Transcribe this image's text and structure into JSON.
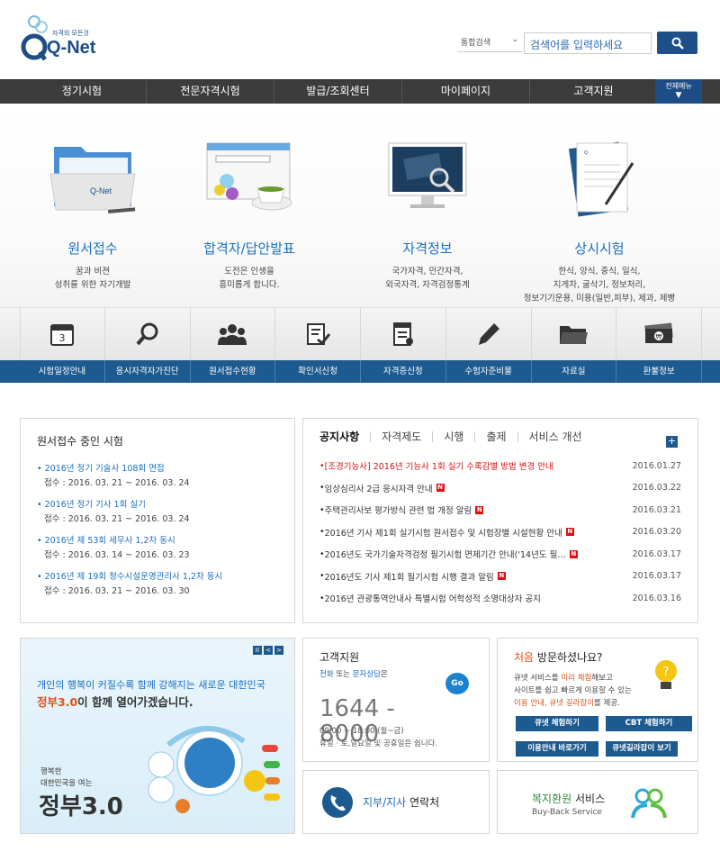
{
  "header": {
    "logo_tagline": "자격의 모든것",
    "logo_text": "Q-Net",
    "search_scope": "통합검색",
    "search_placeholder": "검색어를 입력하세요"
  },
  "nav": {
    "items": [
      "정기시험",
      "전문자격시험",
      "발급/조회센터",
      "마이페이지",
      "고객지원"
    ],
    "all_menu": "전체메뉴"
  },
  "services": [
    {
      "title": "원서접수",
      "desc": [
        "꿈과 비젼",
        "성취를 위한 자기개발"
      ]
    },
    {
      "title": "합격자/답안발표",
      "desc": [
        "도전은 인생을",
        "흥미롭게 합니다."
      ]
    },
    {
      "title": "자격정보",
      "desc": [
        "국가자격, 민간자격,",
        "외국자격, 자격검정통계"
      ]
    },
    {
      "title": "상시시험",
      "desc": [
        "한식, 양식, 중식, 일식,",
        "지게차, 굴삭기, 정보처리,",
        "정보기기운용, 미용(일반,피부), 제과, 제빵"
      ]
    }
  ],
  "quick_links": [
    {
      "label": "시험일정안내",
      "icon": "calendar-icon",
      "day": "3"
    },
    {
      "label": "응시자격자가진단",
      "icon": "magnifier-icon"
    },
    {
      "label": "원서접수현황",
      "icon": "people-icon"
    },
    {
      "label": "확인서신청",
      "icon": "certificate-icon"
    },
    {
      "label": "자격증신청",
      "icon": "document-icon"
    },
    {
      "label": "수험자준비물",
      "icon": "pencil-icon"
    },
    {
      "label": "자료실",
      "icon": "folder-icon"
    },
    {
      "label": "환불정보",
      "icon": "money-icon"
    }
  ],
  "exam_panel": {
    "title": "원서접수 중인 시험",
    "items": [
      {
        "name": "2016년 정기 기술사 108회 면접",
        "period": "접수 : 2016. 03. 21 ~ 2016. 03. 24"
      },
      {
        "name": "2016년 정기 기사 1회 실기",
        "period": "접수 : 2016. 03. 21 ~ 2016. 03. 24"
      },
      {
        "name": "2016년 제 53회 세무사 1,2차 동시",
        "period": "접수 : 2016. 03. 14 ~ 2016. 03. 23"
      },
      {
        "name": "2016년 제 19회 청수시설운영관리사 1,2차 동시",
        "period": "접수 : 2016. 03. 21 ~ 2016. 03. 30"
      }
    ]
  },
  "notice_panel": {
    "tabs": [
      "공지사항",
      "자격제도",
      "시행",
      "출제",
      "서비스 개선"
    ],
    "more": "+",
    "new_badge": "N",
    "rows": [
      {
        "title": "[조경기능사] 2016년 기능사 1회 실기 수록감별 방법 변경 안내",
        "date": "2016.01.27",
        "red": true,
        "new": false
      },
      {
        "title": "임상심리사 2급 응시자격 안내",
        "date": "2016.03.22",
        "red": false,
        "new": true
      },
      {
        "title": "주택관리사보 평가방식 관련 법 개정 알림",
        "date": "2016.03.21",
        "red": false,
        "new": true
      },
      {
        "title": "2016년 기사 제1회 실기시험 원서접수 및 시험장별 시설현황 안내",
        "date": "2016.03.20",
        "red": false,
        "new": true
      },
      {
        "title": "2016년도 국가기술자격검정 필기시험 면제기간 안내('14년도 필…",
        "date": "2016.03.17",
        "red": false,
        "new": true
      },
      {
        "title": "2016년도 기사 제1회 필기시험 시행 결과 알림",
        "date": "2016.03.17",
        "red": false,
        "new": true
      },
      {
        "title": "2016년 관광통역안내사 특별시험 어학성적 소명대상자 공지",
        "date": "2016.03.16",
        "red": false,
        "new": false
      }
    ]
  },
  "gov_banner": {
    "line1": "개인의 행복이 커질수록 함께 강해지는 새로운 대한민국",
    "em": "정부3.0",
    "line2": "이 함께 열어가겠습니다.",
    "sub1": "행복한",
    "sub2": "대한민국을 여는",
    "big": "정부3.0",
    "controls": [
      "II",
      "<",
      ">"
    ]
  },
  "customer_support": {
    "title": "고객지원",
    "sub_phone": "전화",
    "sub_mid": " 또는 ",
    "sub_sms": "문자상담",
    "sub_end": "은",
    "phone": "1644 - 8000",
    "hours": "09:00 ~ 18:00 (월~금)",
    "holiday": "휴일 · 토,일요일 및 공휴일은 쉽니다.",
    "go": "Go"
  },
  "branch": {
    "label_blue": "지부/지사",
    "label_rest": " 연락처"
  },
  "first_visit": {
    "title_o": "처음",
    "title_rest": " 방문하셨나요?",
    "desc1": "큐넷 서비스를 ",
    "desc1_o": "미리 체험",
    "desc1_end": "해보고",
    "desc2": "사이트를 쉽고 빠르게 이용할 수 있는",
    "desc3_o": "이용 안내, 큐넷 길라잡이",
    "desc3_end": "를 제공.",
    "buttons": [
      "큐넷 체험하기",
      "CBT 체험하기",
      "이용안내 바로가기",
      "큐넷길라잡이 보기"
    ]
  },
  "buyback": {
    "title_green": "복지환원",
    "title_rest": " 서비스",
    "sub": "Buy-Back Service"
  }
}
